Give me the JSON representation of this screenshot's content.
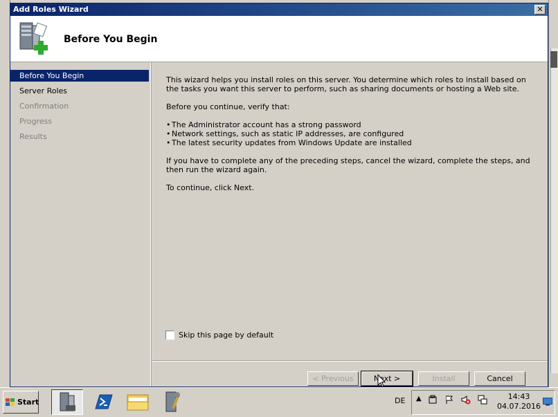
{
  "window": {
    "title": "Add Roles Wizard",
    "close_symbol": "✕"
  },
  "header": {
    "title": "Before You Begin",
    "icon": "server-roles-add-icon"
  },
  "nav": {
    "items": [
      {
        "label": "Before You Begin",
        "state": "active"
      },
      {
        "label": "Server Roles",
        "state": "enabled"
      },
      {
        "label": "Confirmation",
        "state": "disabled"
      },
      {
        "label": "Progress",
        "state": "disabled"
      },
      {
        "label": "Results",
        "state": "disabled"
      }
    ]
  },
  "content": {
    "intro": "This wizard helps you install roles on this server. You determine which roles to install based on the tasks you want this server to perform, such as sharing documents or hosting a Web site.",
    "verify": "Before you continue, verify that:",
    "bullets": [
      "The Administrator account has a strong password",
      "Network settings, such as static IP addresses, are configured",
      "The latest security updates from Windows Update are installed"
    ],
    "preceding": "If you have to complete any of the preceding steps, cancel the wizard, complete the steps, and then run the wizard again.",
    "continue": "To continue, click Next."
  },
  "skip": {
    "label": "Skip this page by default",
    "checked": false
  },
  "buttons": {
    "previous": "< Previous",
    "next": "Next >",
    "install": "Install",
    "cancel": "Cancel"
  },
  "taskbar": {
    "start": "Start",
    "apps": [
      "server-manager-icon",
      "powershell-icon",
      "explorer-folder-icon",
      "admin-tools-icon"
    ],
    "language": "DE",
    "time": "14:43",
    "date": "04.07.2016"
  },
  "colors": {
    "selection": "#0a246a",
    "title_start": "#0a246a",
    "title_end": "#3a6ea5",
    "face": "#d4d0c8"
  }
}
